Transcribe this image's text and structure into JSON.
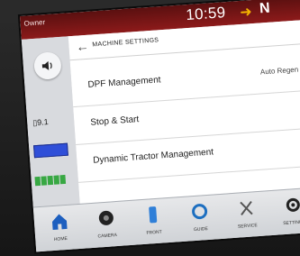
{
  "statusbar": {
    "owner": "Owner",
    "time": "10:59",
    "gear": "N"
  },
  "sidebar": {
    "value_label": "9.1"
  },
  "header": {
    "title": "MACHINE SETTINGS"
  },
  "rows": [
    {
      "label": "DPF Management",
      "value": "Auto Regen"
    },
    {
      "label": "Stop & Start",
      "value": ""
    },
    {
      "label": "Dynamic Tractor Management",
      "value": ""
    }
  ],
  "nav": [
    {
      "label": "HOME",
      "icon": "home-icon"
    },
    {
      "label": "CAMERA",
      "icon": "camera-icon"
    },
    {
      "label": "FRONT",
      "icon": "front-icon"
    },
    {
      "label": "GUIDE",
      "icon": "guide-icon"
    },
    {
      "label": "SERVICE",
      "icon": "wrench-icon"
    },
    {
      "label": "SETTINGS",
      "icon": "gear-icon"
    }
  ],
  "colors": {
    "status_red": "#8d1a1a",
    "accent_blue": "#2f4fd8",
    "green": "#38a843"
  }
}
